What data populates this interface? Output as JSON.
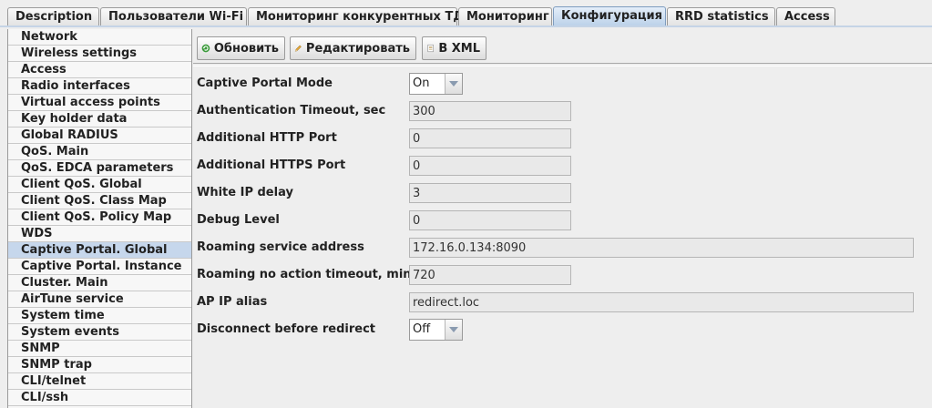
{
  "tabs": [
    "Description",
    "Пользователи Wi-Fi",
    "Мониторинг конкурентных ТД",
    "Мониторинг",
    "Конфигурация",
    "RRD statistics",
    "Access"
  ],
  "active_tab": "Конфигурация",
  "sidebar": {
    "selected": "Captive Portal. Global",
    "items": [
      "Network",
      "Wireless settings",
      "Access",
      "Radio interfaces",
      "Virtual access points",
      "Key holder data",
      "Global RADIUS",
      "QoS. Main",
      "QoS. EDCA parameters",
      "Client QoS. Global",
      "Client QoS. Class Map",
      "Client QoS. Policy Map",
      "WDS",
      "Captive Portal. Global",
      "Captive Portal. Instance",
      "Cluster. Main",
      "AirTune service",
      "System time",
      "System events",
      "SNMP",
      "SNMP trap",
      "CLI/telnet",
      "CLI/ssh"
    ]
  },
  "toolbar": {
    "refresh_label": "Обновить",
    "edit_label": "Редактировать",
    "xml_label": "В XML"
  },
  "form": {
    "captive_portal_mode": {
      "label": "Captive Portal Mode",
      "value": "On"
    },
    "auth_timeout": {
      "label": "Authentication Timeout, sec",
      "value": "300"
    },
    "http_port": {
      "label": "Additional HTTP Port",
      "value": "0"
    },
    "https_port": {
      "label": "Additional HTTPS Port",
      "value": "0"
    },
    "white_ip_delay": {
      "label": "White IP delay",
      "value": "3"
    },
    "debug_level": {
      "label": "Debug Level",
      "value": "0"
    },
    "roaming_address": {
      "label": "Roaming service address",
      "value": "172.16.0.134:8090"
    },
    "roaming_timeout": {
      "label": "Roaming no action timeout, min",
      "value": "720"
    },
    "ap_ip_alias": {
      "label": "AP IP alias",
      "value": "redirect.loc"
    },
    "disconnect_redirect": {
      "label": "Disconnect before redirect",
      "value": "Off"
    }
  },
  "colors": {
    "accent": "#c6d7ec",
    "active_tab": "#b8cfe8"
  }
}
